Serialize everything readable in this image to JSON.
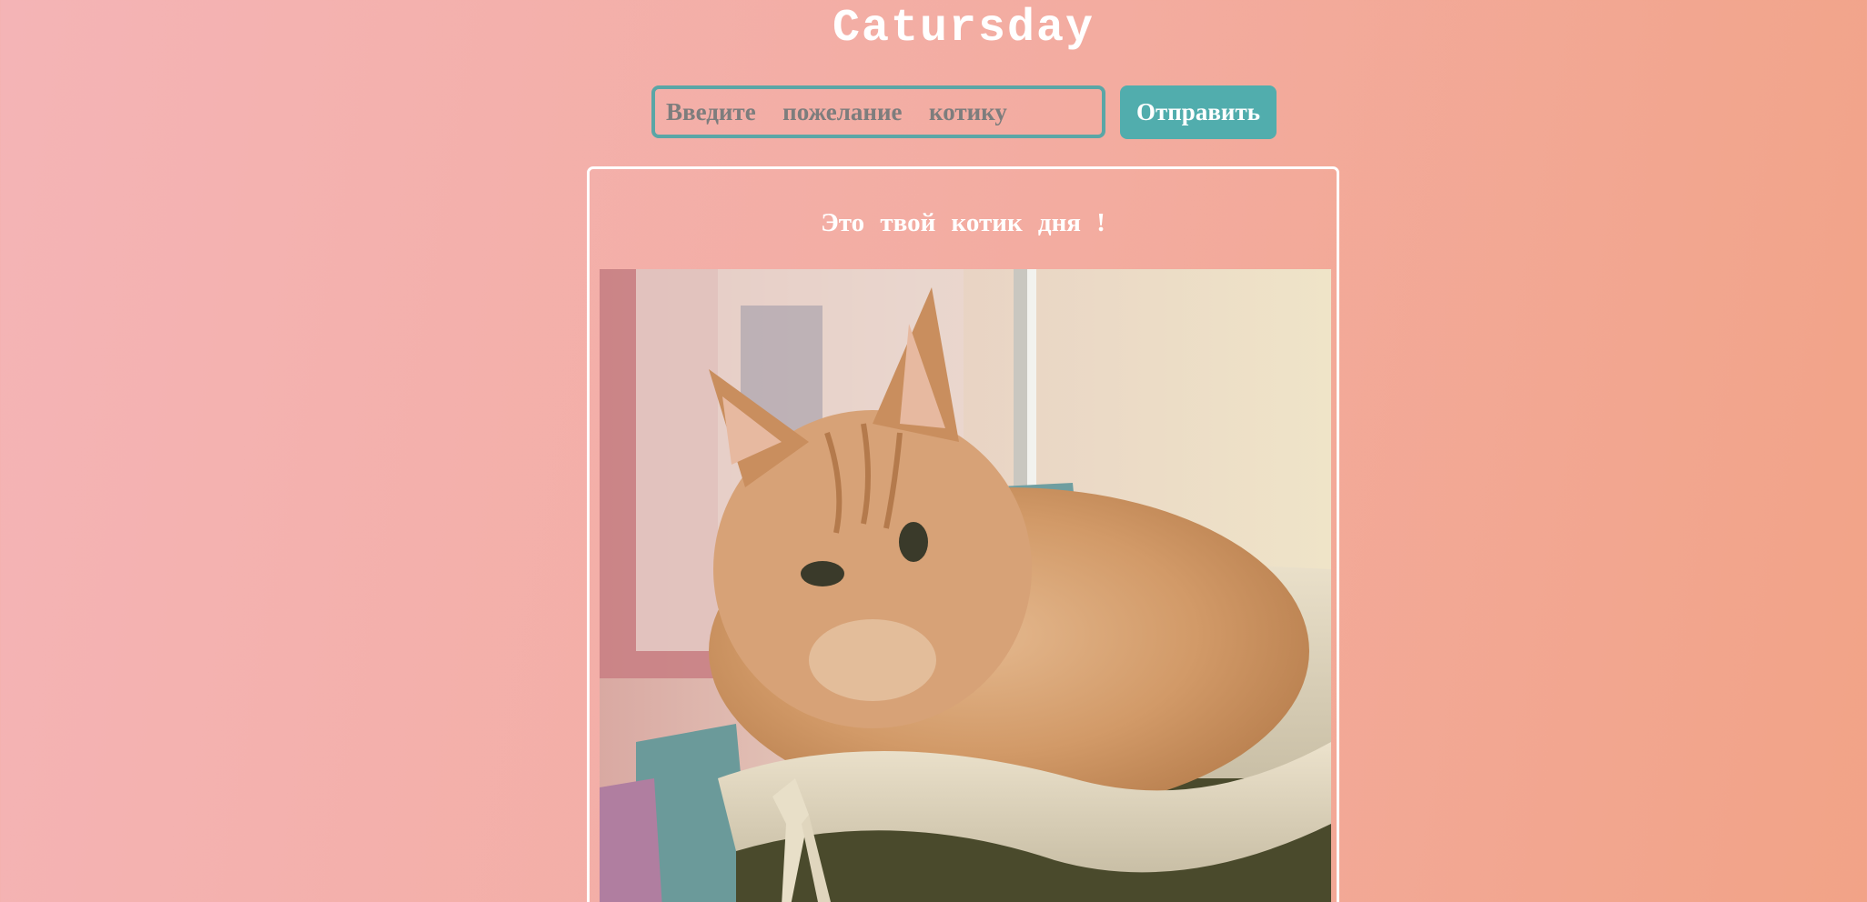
{
  "app": {
    "title": "Catursday"
  },
  "form": {
    "input_value": "",
    "input_placeholder": "Введите  пожелание  котику",
    "submit_label": "Отправить"
  },
  "card": {
    "heading": "Это  твой  котик  дня !",
    "photo_subject": "ginger-cat-in-basket"
  },
  "colors": {
    "background_start": "#f4b4b6",
    "background_end": "#f2a387",
    "accent": "#51adad",
    "text": "#ffffff"
  }
}
